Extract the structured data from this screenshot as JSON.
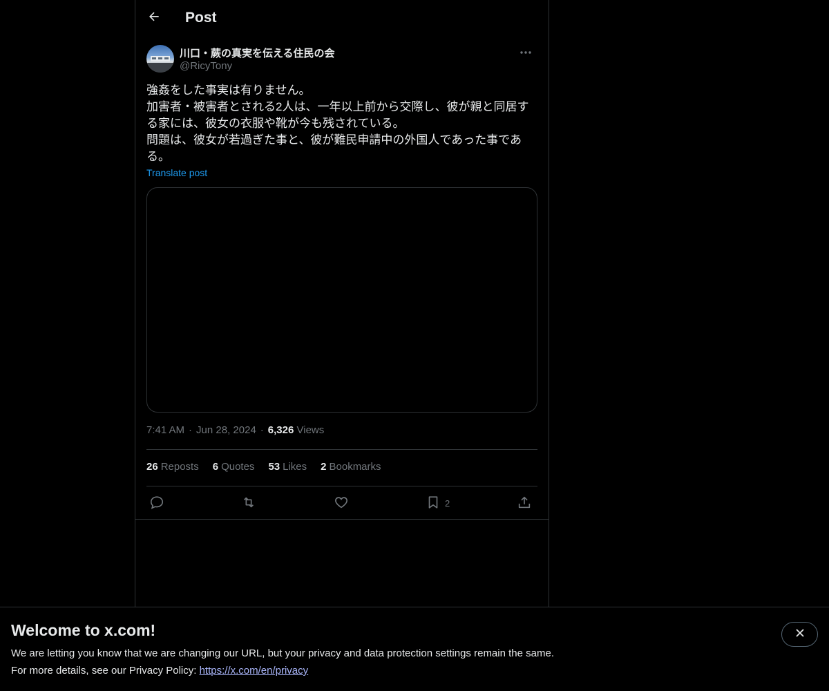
{
  "header": {
    "title": "Post"
  },
  "author": {
    "name": "川口・蕨の真実を伝える住民の会",
    "handle": "@RicyTony"
  },
  "post": {
    "text": "強姦をした事実は有りません。\n加害者・被害者とされる2人は、一年以上前から交際し、彼が親と同居する家には、彼女の衣服や靴が今も残されている。\n問題は、彼女が若過ぎた事と、彼が難民申請中の外国人であった事である。",
    "translate_label": "Translate post"
  },
  "meta": {
    "time": "7:41 AM",
    "separator": "·",
    "date": "Jun 28, 2024",
    "views_count": "6,326",
    "views_label": "Views"
  },
  "stats": [
    {
      "count": "26",
      "label": "Reposts"
    },
    {
      "count": "6",
      "label": "Quotes"
    },
    {
      "count": "53",
      "label": "Likes"
    },
    {
      "count": "2",
      "label": "Bookmarks"
    }
  ],
  "actions": {
    "bookmark_count": "2",
    "icons": [
      "reply-icon",
      "repost-icon",
      "like-icon",
      "bookmark-icon",
      "share-icon"
    ]
  },
  "banner": {
    "title": "Welcome to x.com!",
    "line1": "We are letting you know that we are changing our URL, but your privacy and data protection settings remain the same.",
    "line2_prefix": "For more details, see our Privacy Policy: ",
    "link": "https://x.com/en/privacy"
  },
  "colors": {
    "background": "#000000",
    "text": "#e7e9ea",
    "secondary": "#71767b",
    "accent": "#1d9bf0",
    "border": "#2f3336"
  }
}
